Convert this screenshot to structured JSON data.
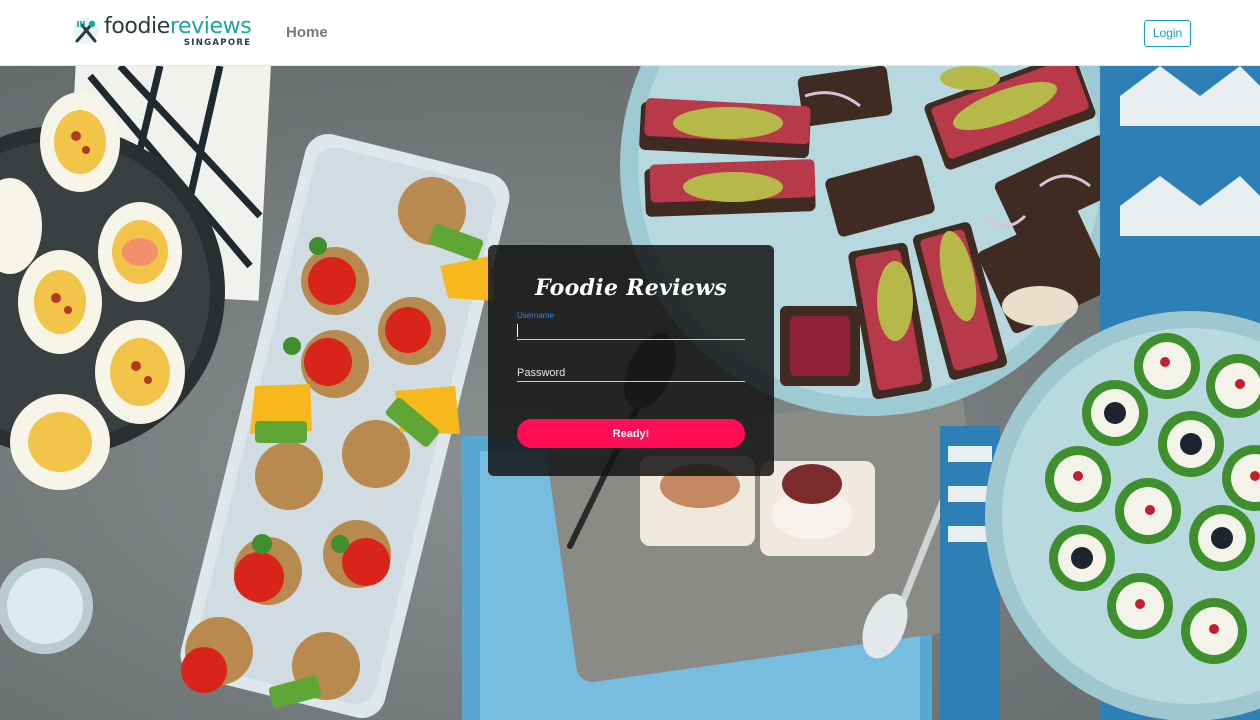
{
  "navbar": {
    "brand_word_1": "foodie",
    "brand_word_2": "reviews",
    "brand_sub": "SINGAPORE",
    "home_label": "Home",
    "login_label": "Login"
  },
  "login_card": {
    "title": "Foodie Reviews",
    "username_label": "Username",
    "username_value": "",
    "password_placeholder": "Password",
    "submit_label": "Ready!"
  },
  "colors": {
    "brand_teal": "#17a99a",
    "login_outline": "#17a2b8",
    "submit_pink": "#ff0d57",
    "username_label_blue": "#2d8cf0"
  },
  "icons": [
    "fork-knife-icon"
  ]
}
